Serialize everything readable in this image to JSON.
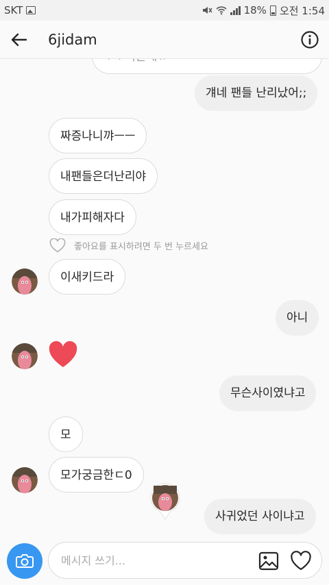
{
  "status_bar": {
    "carrier": "SKT",
    "battery": "18%",
    "time": "오전 1:54"
  },
  "header": {
    "title": "6jidam"
  },
  "messages": {
    "partial_top": "ㅜㅜ러운데ㅠ",
    "out_1": "걔네 팬들 난리났어;;",
    "in_1": "짜증나니꺄ㅡㅡ",
    "in_2": "내팬들은더난리야",
    "in_3": "내가피해자다",
    "like_hint": "좋아요를 표시하려면 두 번 누르세요",
    "in_4": "이새키드라",
    "out_2": "아니",
    "out_3": "무슨사이였냐고",
    "in_5": "모",
    "in_6": "모가궁금한ㄷ0",
    "out_4": "사귀었던 사이냐고"
  },
  "composer": {
    "placeholder": "메시지 쓰기..."
  },
  "colors": {
    "accent": "#3897f0",
    "heart": "#ed4956"
  },
  "icons": [
    "back-arrow-icon",
    "info-icon",
    "camera-icon",
    "photo-icon",
    "heart-icon"
  ]
}
